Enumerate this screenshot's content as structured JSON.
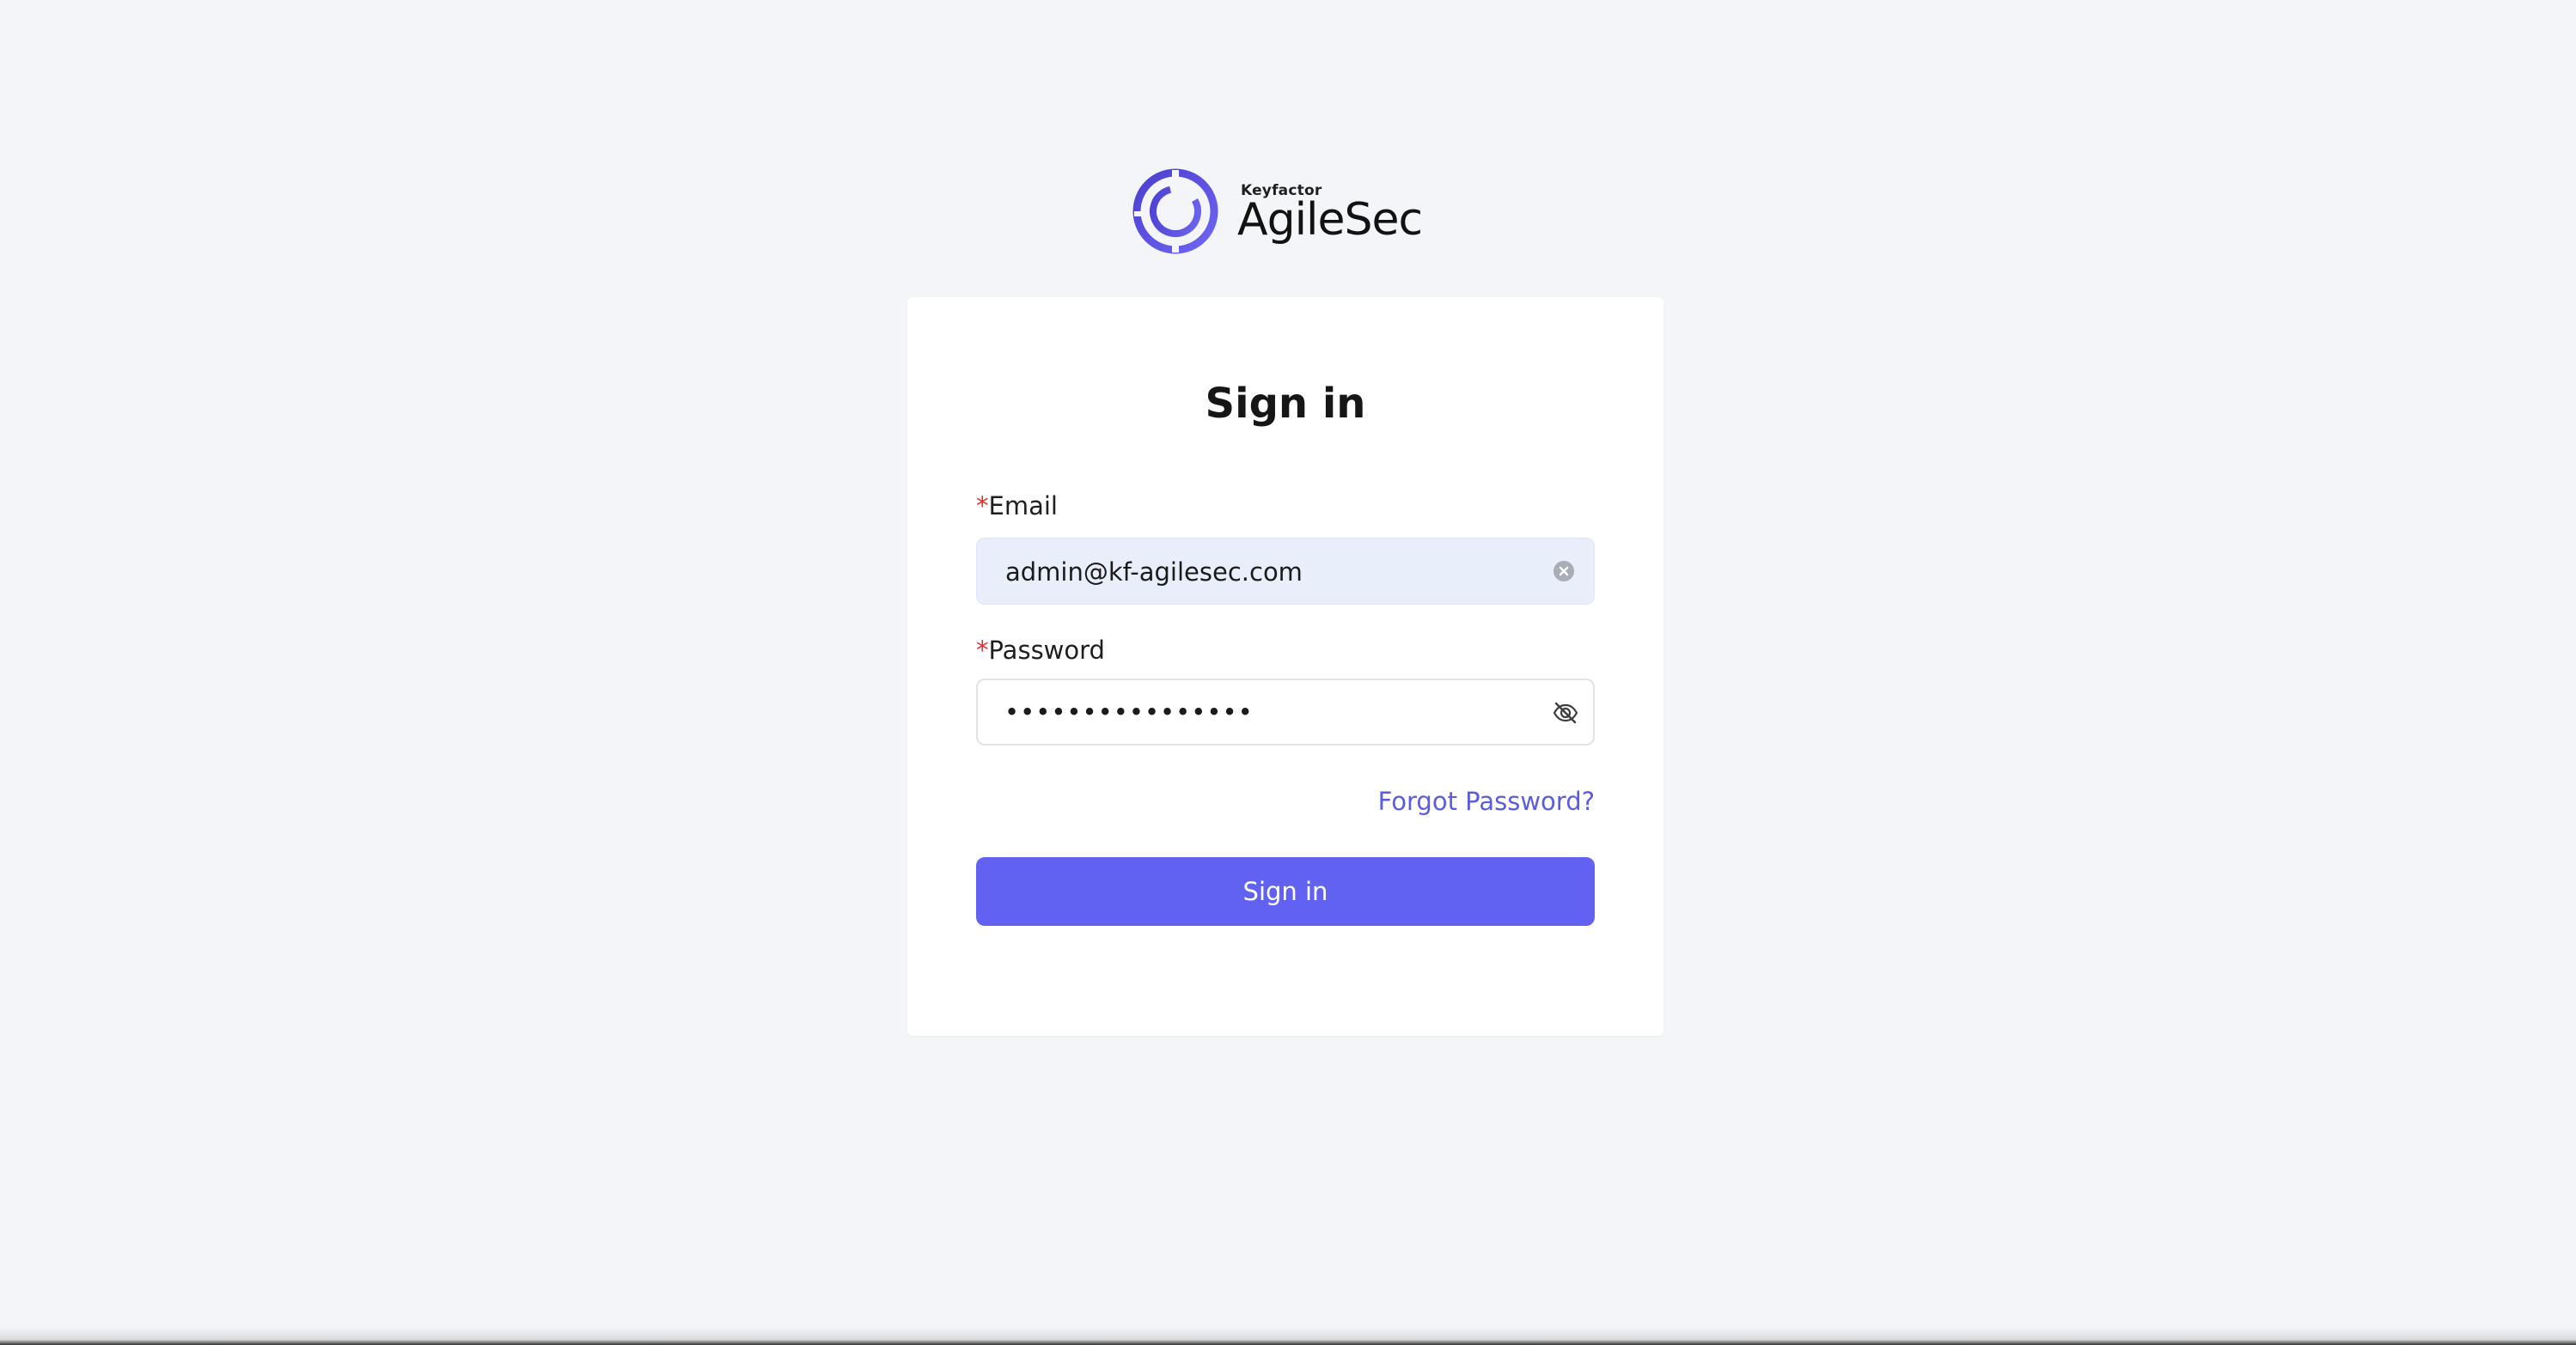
{
  "brand": {
    "kicker": "Keyfactor",
    "name": "AgileSec",
    "accent_color": "#5b5ce0",
    "icon": "ring-logo-icon"
  },
  "form": {
    "title": "Sign in",
    "email": {
      "required_marker": "*",
      "label": "Email",
      "value": "admin@kf-agilesec.com",
      "clear_icon": "clear-circle-icon"
    },
    "password": {
      "required_marker": "*",
      "label": "Password",
      "masked_value": "••••••••••••••••",
      "visibility_icon": "eye-off-icon"
    },
    "forgot_password": "Forgot Password?",
    "submit_label": "Sign in"
  },
  "colors": {
    "page_background": "#f4f5f9",
    "primary_button": "#6162f1",
    "required": "#e0302f",
    "email_field_fill": "#e8effb"
  }
}
